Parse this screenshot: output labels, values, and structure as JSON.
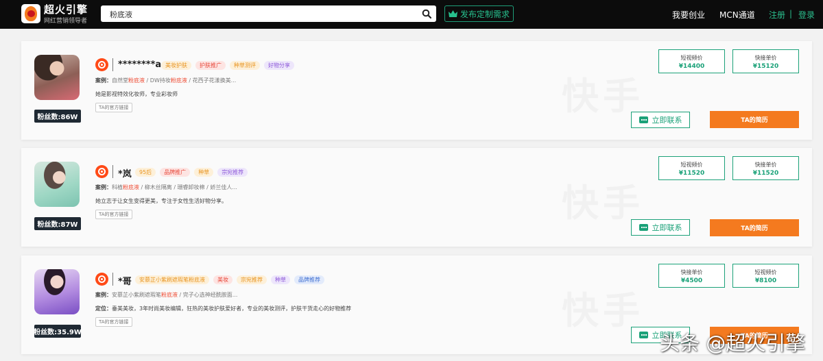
{
  "header": {
    "brand": "超火引擎",
    "slogan": "网红营销领导者",
    "search_value": "粉底液",
    "post_demand": "发布定制需求",
    "nav": [
      "我要创业",
      "MCN通道"
    ],
    "register": "注册",
    "separator": "|",
    "login": "登录"
  },
  "cards": [
    {
      "name": "********a",
      "tags": [
        "美妆护肤",
        "护肤推广",
        "种草测评",
        "好物分享"
      ],
      "case_label": "案例：",
      "case_parts": [
        "自然堂",
        "粉底液",
        " / DW持妆",
        "粉底液",
        " / 花西子花漾换美..."
      ],
      "description": "她是影视特效化妆师，专业彩妆师",
      "official_link": "TA的官方链接",
      "fans": "粉丝数:86W",
      "prices": [
        {
          "label": "短视频价",
          "value": "¥14400"
        },
        {
          "label": "快接单价",
          "value": "¥15120"
        }
      ],
      "contact": "立即联系",
      "resume": "TA的简历"
    },
    {
      "name": "*岚",
      "tags": [
        "95后",
        "品牌推广",
        "种草",
        "宗宛推荐"
      ],
      "case_label": "案例：",
      "case_parts": [
        "科植",
        "粉底液",
        " / 柳木丝隔离 / 珊睿卸妆棉 / 娇兰佳人..."
      ],
      "description": "她立志于让女生变得更美，专注于女性生活好物分享。",
      "official_link": "TA的官方链接",
      "fans": "粉丝数:87W",
      "prices": [
        {
          "label": "短视频价",
          "value": "¥11520"
        },
        {
          "label": "快接单价",
          "value": "¥11520"
        }
      ],
      "contact": "立即联系",
      "resume": "TA的简历"
    },
    {
      "name": "*哥",
      "tags": [
        "安慕芷小紫刷遮瑕笔粉底液",
        "美妆",
        "宗宛推荐",
        "种草",
        "品牌推荐"
      ],
      "case_label": "案例：",
      "case_parts": [
        "安慕芷小紫刷遮瑕笔",
        "粉底液",
        " / 完子心选神经酰胺面..."
      ],
      "position_label": "定位：",
      "description": "垂美美妆，3年时尚美妆编辑，狂热的美妆护肤爱好者，专业的美妆测评，护肤干货走心的好物推荐",
      "official_link": "TA的官方链接",
      "fans": "粉丝数:35.9W",
      "prices": [
        {
          "label": "快接单价",
          "value": "¥4500"
        },
        {
          "label": "短视频价",
          "value": "¥8100"
        }
      ],
      "contact": "立即联系",
      "resume": "TA的简历"
    }
  ],
  "watermark": "快手",
  "credit": "头条 @超火引擎",
  "colors": {
    "accent_green": "#1aa178",
    "accent_orange": "#f47a1f",
    "highlight_red": "#ee4b33",
    "topbar": "#0c0c0c"
  }
}
